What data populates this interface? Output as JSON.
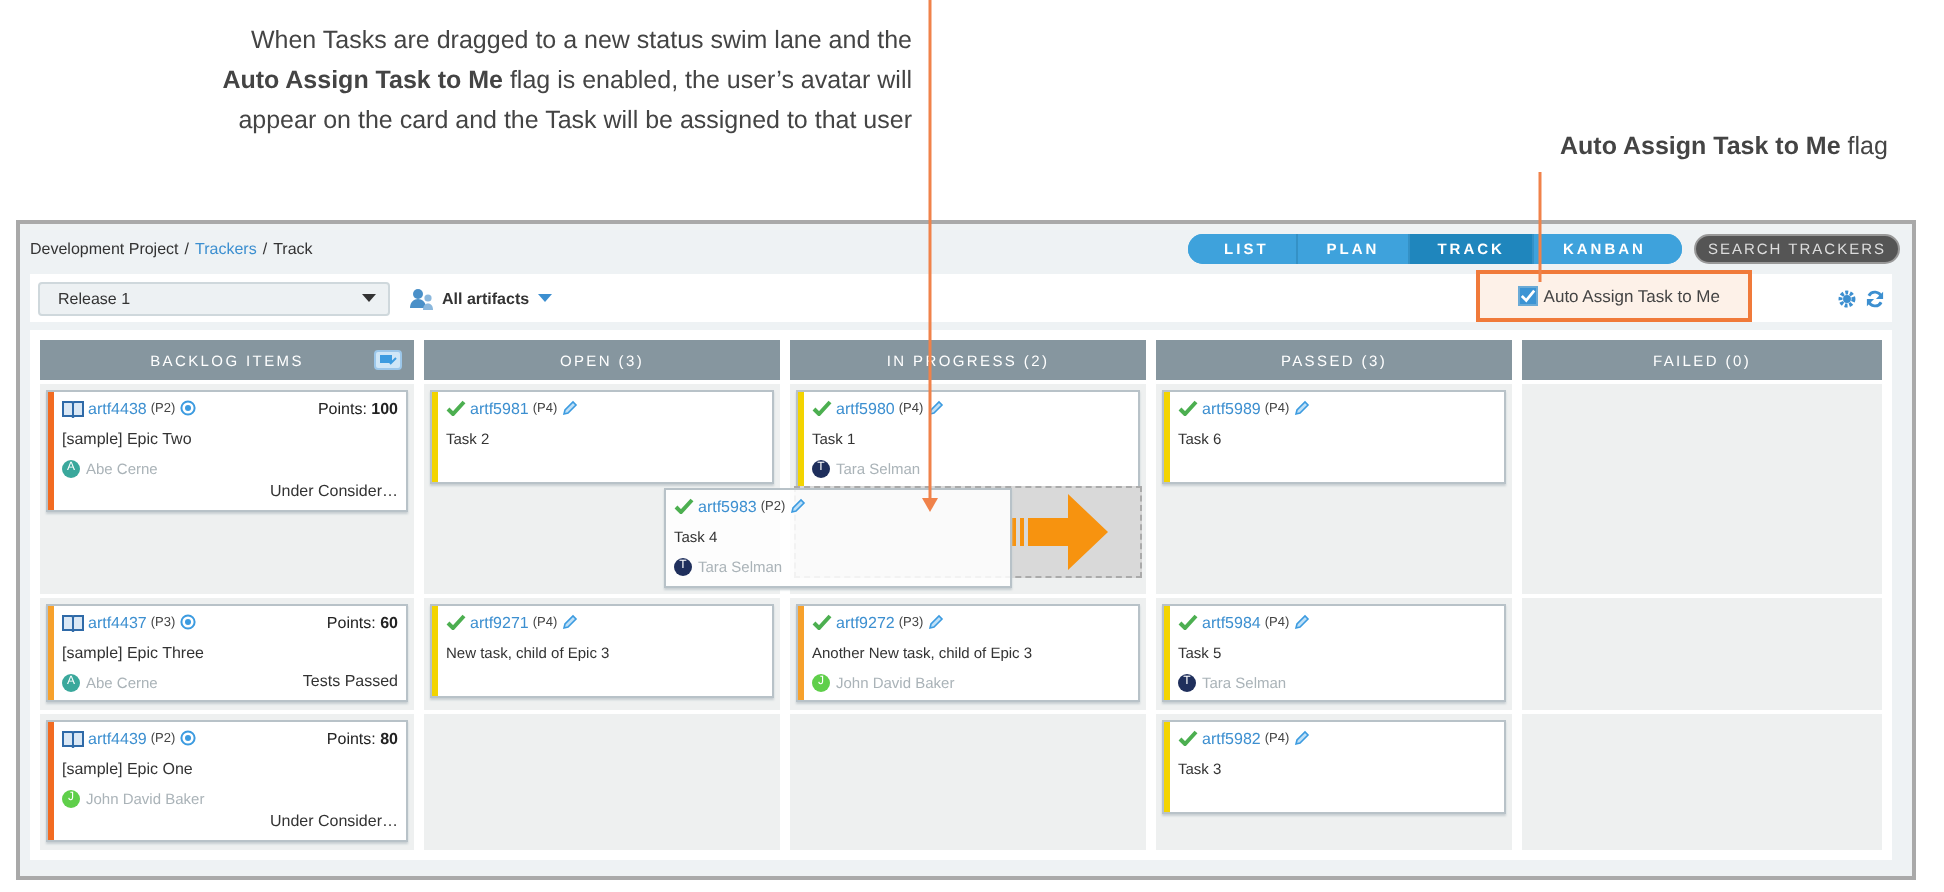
{
  "annotations": {
    "main": "When Tasks are dragged to a new status swim lane and the **Auto Assign Task to Me** flag is enabled, the user’s avatar will appear on the card and the Task will be assigned to that user",
    "flag": "**Auto Assign Task to Me** flag"
  },
  "breadcrumb": [
    {
      "kind": "text",
      "label": "Development Project"
    },
    {
      "kind": "separator",
      "label": "/"
    },
    {
      "kind": "link",
      "label": "Trackers"
    },
    {
      "kind": "separator",
      "label": "/"
    },
    {
      "kind": "text",
      "label": "Track"
    }
  ],
  "view_tabs": [
    {
      "label": "LIST",
      "selected": false
    },
    {
      "label": "PLAN",
      "selected": false
    },
    {
      "label": "TRACK",
      "selected": true
    },
    {
      "label": "KANBAN",
      "selected": false
    }
  ],
  "search_button": "SEARCH TRACKERS",
  "release_select": {
    "value": "Release 1"
  },
  "filter": {
    "label": "All artifacts"
  },
  "auto_assign": {
    "label": "Auto Assign Task to Me",
    "checked": true
  },
  "columns": [
    {
      "title": "BACKLOG ITEMS"
    },
    {
      "title": "OPEN (3)"
    },
    {
      "title": "IN PROGRESS (2)"
    },
    {
      "title": "PASSED (3)"
    },
    {
      "title": "FAILED (0)"
    }
  ],
  "swimlanes": [
    {
      "backlog": {
        "id": "artf4438",
        "priority": "(P2)",
        "points": "Points: **100**",
        "title": "[sample] Epic Two",
        "assignee": {
          "initial": "A",
          "name": "Abe Cerne",
          "color": "#3aa89c"
        },
        "status": "Under Consider…",
        "color": "#f26b21"
      },
      "open": [
        {
          "id": "artf5981",
          "priority": "(P4)",
          "title": "Task 2",
          "color": "#f3d400"
        }
      ],
      "in_progress": [
        {
          "id": "artf5980",
          "priority": "(P4)",
          "title": "Task 1",
          "assignee": {
            "initial": "T",
            "name": "Tara Selman",
            "color": "#1f2f5c"
          },
          "color": "#f3d400"
        }
      ],
      "passed": [
        {
          "id": "artf5989",
          "priority": "(P4)",
          "title": "Task 6",
          "color": "#f3d400"
        }
      ]
    },
    {
      "backlog": {
        "id": "artf4437",
        "priority": "(P3)",
        "points": "Points: **60**",
        "title": "[sample] Epic Three",
        "assignee": {
          "initial": "A",
          "name": "Abe Cerne",
          "color": "#3aa89c"
        },
        "status": "Tests Passed",
        "color": "#f7a12b"
      },
      "open": [
        {
          "id": "artf9271",
          "priority": "(P4)",
          "title": "New task, child of Epic 3",
          "color": "#f3d400"
        }
      ],
      "in_progress": [
        {
          "id": "artf9272",
          "priority": "(P3)",
          "title": "Another New task, child of Epic 3",
          "assignee": {
            "initial": "J",
            "name": "John David Baker",
            "color": "#5fcf4a"
          },
          "color": "#f7a12b"
        }
      ],
      "passed": [
        {
          "id": "artf5984",
          "priority": "(P4)",
          "title": "Task 5",
          "assignee": {
            "initial": "T",
            "name": "Tara Selman",
            "color": "#1f2f5c"
          },
          "color": "#f3d400"
        }
      ]
    },
    {
      "backlog": {
        "id": "artf4439",
        "priority": "(P2)",
        "points": "Points: **80**",
        "title": "[sample] Epic One",
        "assignee": {
          "initial": "J",
          "name": "John David Baker",
          "color": "#5fcf4a"
        },
        "status": "Under Consider…",
        "color": "#f26b21"
      },
      "passed": [
        {
          "id": "artf5982",
          "priority": "(P4)",
          "title": "Task 3",
          "color": "#f3d400"
        }
      ]
    }
  ],
  "dragged_card": {
    "id": "artf5983",
    "priority": "(P2)",
    "title": "Task 4",
    "assignee": {
      "initial": "T",
      "name": "Tara Selman",
      "color": "#1f2f5c"
    }
  }
}
